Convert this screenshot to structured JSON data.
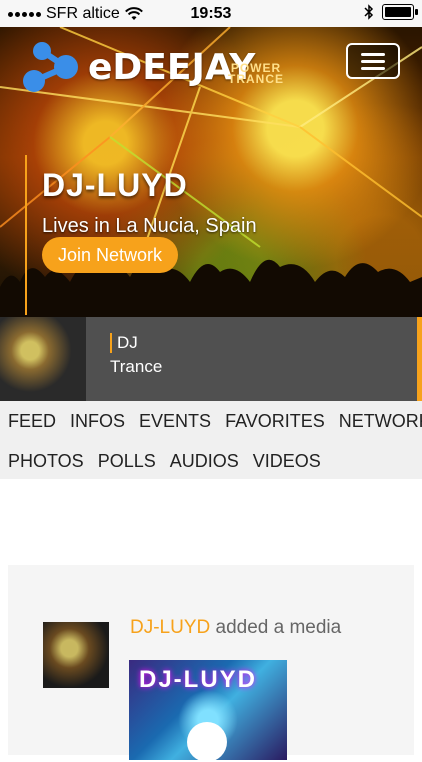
{
  "status_bar": {
    "carrier": "SFR altice",
    "time": "19:53"
  },
  "header": {
    "logo_text": "eDEEJAY",
    "logo_sub_line1": "POWER",
    "logo_sub_line2": "TRANCE"
  },
  "profile": {
    "name": "DJ-LUYD",
    "location": "Lives in La Nucia, Spain",
    "join_label": "Join Network",
    "genre_1": "DJ",
    "genre_2": "Trance"
  },
  "tabs": {
    "row1": [
      "FEED",
      "INFOS",
      "EVENTS",
      "FAVORITES",
      "NETWORK"
    ],
    "row2": [
      "PHOTOS",
      "POLLS",
      "AUDIOS",
      "VIDEOS"
    ]
  },
  "feed": {
    "author": "DJ-LUYD",
    "action": "added a media",
    "media_title": "DJ-LUYD"
  },
  "colors": {
    "accent": "#f7a21b",
    "strip": "#505050",
    "tabs_bg": "#f0f0f0"
  }
}
